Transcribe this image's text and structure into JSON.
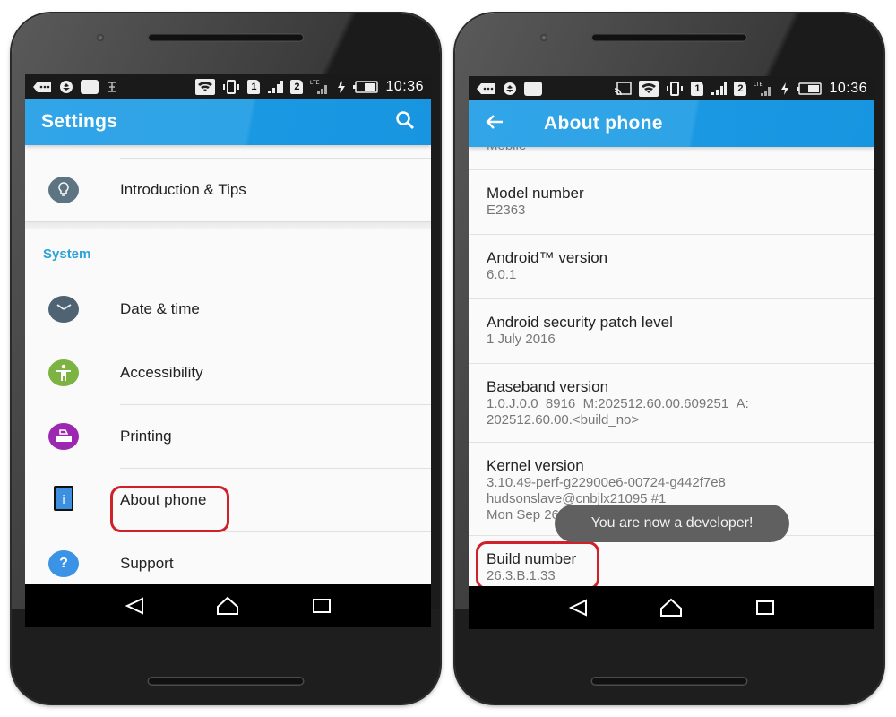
{
  "status_bar": {
    "time": "10:36",
    "sim1_label": "1",
    "sim2_label": "2",
    "network_type": "LTE"
  },
  "left_screen": {
    "appbar": {
      "title": "Settings",
      "search_icon": "search-icon"
    },
    "items_top": [
      {
        "label": "Introduction & Tips",
        "icon": "lightbulb-icon"
      }
    ],
    "section_header": "System",
    "items_system": [
      {
        "label": "Date & time",
        "icon": "clock-icon"
      },
      {
        "label": "Accessibility",
        "icon": "accessibility-icon"
      },
      {
        "label": "Printing",
        "icon": "printer-icon"
      },
      {
        "label": "About phone",
        "icon": "info-icon",
        "highlighted": true
      },
      {
        "label": "Support",
        "icon": "help-icon"
      }
    ]
  },
  "right_screen": {
    "appbar": {
      "title": "About phone",
      "back_icon": "back-arrow-icon"
    },
    "partial_top_text": "Mobile",
    "items": [
      {
        "title": "Model number",
        "value": "E2363"
      },
      {
        "title": "Android™ version",
        "value": "6.0.1"
      },
      {
        "title": "Android security patch level",
        "value": "1 July 2016"
      },
      {
        "title": "Baseband version",
        "value": "1.0.J.0.0_8916_M:202512.60.00.609251_A:\n202512.60.00.<build_no>"
      },
      {
        "title": "Kernel version",
        "value": "3.10.49-perf-g22900e6-00724-g442f7e8\nhudsonslave@cnbjlx21095 #1\nMon Sep 26 08:16:37 CST 2016"
      },
      {
        "title": "Build number",
        "value": "26.3.B.1.33",
        "highlighted": true
      }
    ],
    "toast": "You are now a developer!"
  },
  "nav_bar": {
    "back": "back-icon",
    "home": "home-icon",
    "recents": "recents-icon"
  },
  "colors": {
    "appbar": "#2ea3e6",
    "section_header": "#2ea3d9",
    "highlight": "#d0202a",
    "toast_bg": "#606060"
  }
}
